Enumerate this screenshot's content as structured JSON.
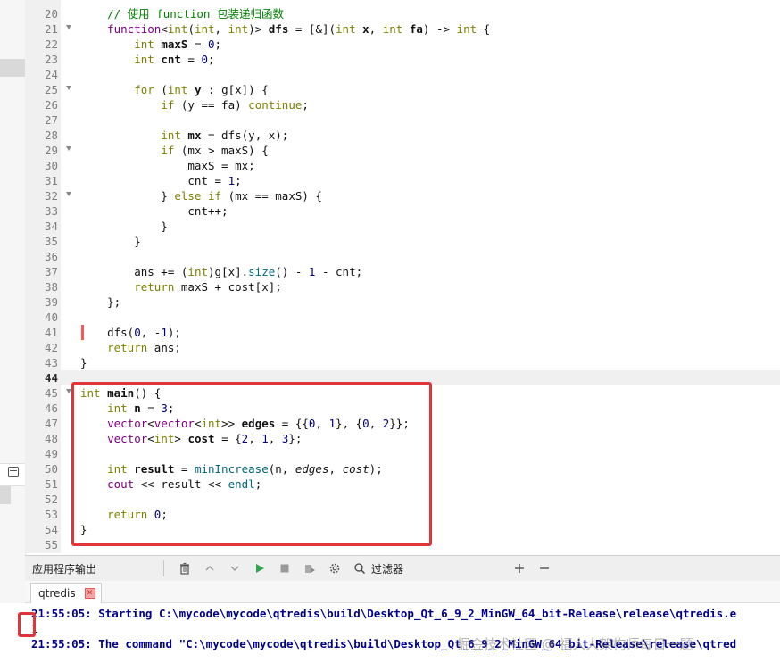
{
  "editor": {
    "lines": [
      {
        "n": "20",
        "html": "    <span class='cm'>// 使用 function 包装递归函数</span>"
      },
      {
        "n": "21",
        "fold": true,
        "html": "    <span class='ty'>function</span>&lt;<span class='kw'>int</span>(<span class='kw'>int</span>, <span class='kw'>int</span>)&gt; <span class='b'>dfs</span> = [&amp;](<span class='kw'>int</span> <span class='b'>x</span>, <span class='kw'>int</span> <span class='b'>fa</span>) -&gt; <span class='kw'>int</span> {"
      },
      {
        "n": "22",
        "html": "        <span class='kw'>int</span> <span class='b'>maxS</span> = <span class='num'>0</span>;"
      },
      {
        "n": "23",
        "html": "        <span class='kw'>int</span> <span class='b'>cnt</span> = <span class='num'>0</span>;"
      },
      {
        "n": "24",
        "html": ""
      },
      {
        "n": "25",
        "fold": true,
        "html": "        <span class='kw'>for</span> (<span class='kw'>int</span> <span class='b'>y</span> : g[x]) {"
      },
      {
        "n": "26",
        "html": "            <span class='kw'>if</span> (y == fa) <span class='kw'>continue</span>;"
      },
      {
        "n": "27",
        "html": ""
      },
      {
        "n": "28",
        "html": "            <span class='kw'>int</span> <span class='b'>mx</span> = dfs(y, x);"
      },
      {
        "n": "29",
        "fold": true,
        "html": "            <span class='kw'>if</span> (mx &gt; maxS) {"
      },
      {
        "n": "30",
        "html": "                maxS = mx;"
      },
      {
        "n": "31",
        "html": "                cnt = <span class='num'>1</span>;"
      },
      {
        "n": "32",
        "fold": true,
        "html": "            } <span class='kw'>else</span> <span class='kw'>if</span> (mx == maxS) {"
      },
      {
        "n": "33",
        "html": "                cnt++;"
      },
      {
        "n": "34",
        "html": "            }"
      },
      {
        "n": "35",
        "html": "        }"
      },
      {
        "n": "36",
        "html": ""
      },
      {
        "n": "37",
        "html": "        ans += (<span class='kw'>int</span>)g[x].<span class='fn'>size</span>() - <span class='num'>1</span> - cnt;"
      },
      {
        "n": "38",
        "html": "        <span class='kw'>return</span> maxS + cost[x];"
      },
      {
        "n": "39",
        "html": "    };"
      },
      {
        "n": "40",
        "html": ""
      },
      {
        "n": "41",
        "mark": true,
        "html": "    dfs(<span class='num'>0</span>, -<span class='num'>1</span>);"
      },
      {
        "n": "42",
        "html": "    <span class='kw'>return</span> ans;"
      },
      {
        "n": "43",
        "html": "}"
      },
      {
        "n": "44",
        "current": true,
        "html": ""
      },
      {
        "n": "45",
        "fold": true,
        "html": "<span class='kw'>int</span> <span class='b'>main</span>() {"
      },
      {
        "n": "46",
        "html": "    <span class='kw'>int</span> <span class='b'>n</span> = <span class='num'>3</span>;"
      },
      {
        "n": "47",
        "html": "    <span class='ty'>vector</span>&lt;<span class='ty'>vector</span>&lt;<span class='kw'>int</span>&gt;&gt; <span class='b'>edges</span> = {{<span class='num'>0</span>, <span class='num'>1</span>}, {<span class='num'>0</span>, <span class='num'>2</span>}};"
      },
      {
        "n": "48",
        "html": "    <span class='ty'>vector</span>&lt;<span class='kw'>int</span>&gt; <span class='b'>cost</span> = {<span class='num'>2</span>, <span class='num'>1</span>, <span class='num'>3</span>};"
      },
      {
        "n": "49",
        "html": ""
      },
      {
        "n": "50",
        "html": "    <span class='kw'>int</span> <span class='b'>result</span> = <span class='fn'>minIncrease</span>(n, <span class='it'>edges</span>, <span class='it'>cost</span>);"
      },
      {
        "n": "51",
        "html": "    <span class='ty'>cout</span> &lt;&lt; result &lt;&lt; <span class='fn'>endl</span>;"
      },
      {
        "n": "52",
        "html": ""
      },
      {
        "n": "53",
        "html": "    <span class='kw'>return</span> <span class='num'>0</span>;"
      },
      {
        "n": "54",
        "html": "}"
      },
      {
        "n": "55",
        "html": ""
      }
    ]
  },
  "panel": {
    "title": "应用程序输出",
    "filter_label": "过滤器",
    "tab_label": "qtredis",
    "tab_close": "✕"
  },
  "output": {
    "line1": "21:55:05: Starting C:\\mycode\\mycode\\qtredis\\build\\Desktop_Qt_6_9_2_MinGW_64_bit-Release\\release\\qtredis.e",
    "line2": "1",
    "line3": "21:55:05: The command \"C:\\mycode\\mycode\\qtredis\\build\\Desktop_Qt_6_9_2_MinGW_64_bit-Release\\release\\qtred"
  },
  "watermark": "掘金技术社区 @ 福大大架构师每日一题"
}
